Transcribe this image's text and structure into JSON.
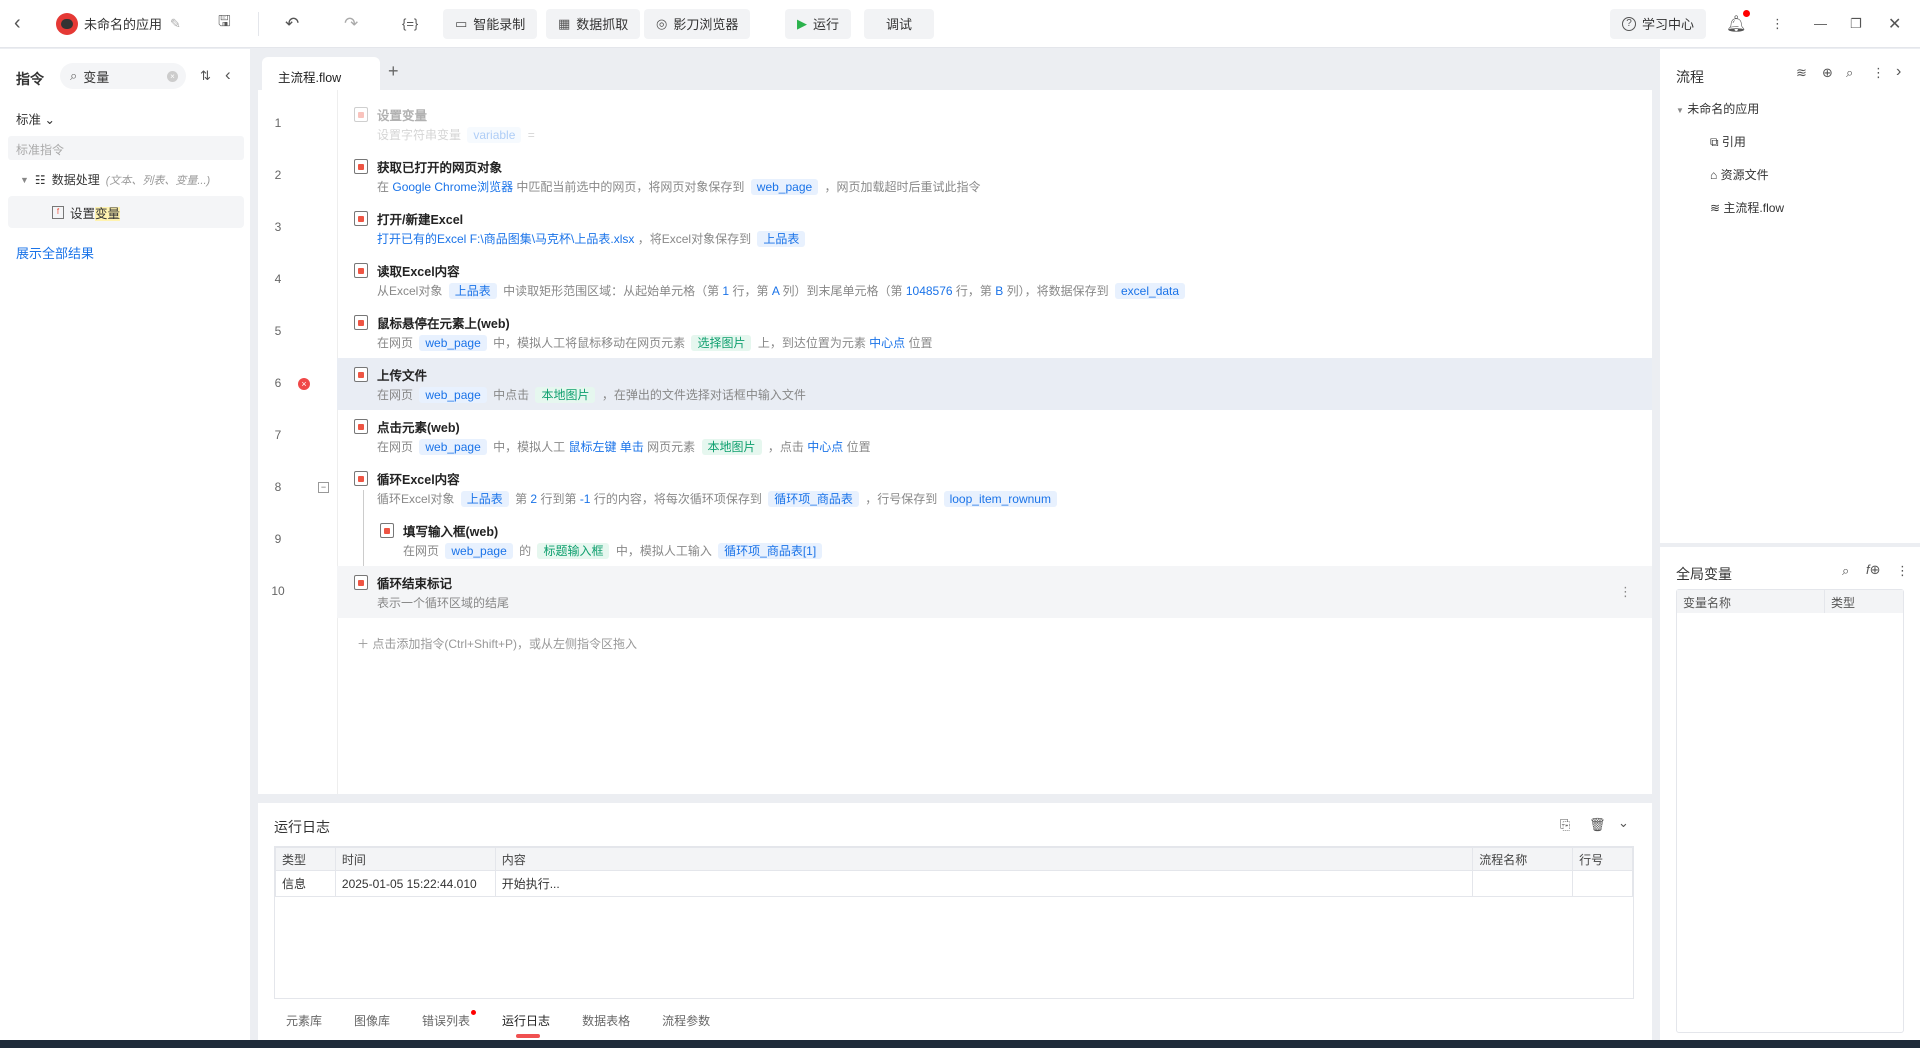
{
  "topbar": {
    "app_title": "未命名的应用",
    "record": "智能录制",
    "scrape": "数据抓取",
    "browser": "影刀浏览器",
    "run": "运行",
    "debug": "调试",
    "learn": "学习中心"
  },
  "left": {
    "title": "指令",
    "search_value": "变量",
    "filter": "标准",
    "category_placeholder": "标准指令",
    "group": "数据处理",
    "group_hint": "(文本、列表、变量...)",
    "item_prefix": "设置",
    "item_highlight": "变量",
    "show_all": "展示全部结果"
  },
  "editor": {
    "tab": "主流程.flow",
    "add_hint": "点击添加指令(Ctrl+Shift+P)，或从左侧指令区拖入",
    "rows": [
      {
        "n": "1",
        "title": "设置变量",
        "disabled": true,
        "desc": [
          {
            "t": "设置字符串变量",
            "k": "p"
          },
          {
            "t": "variable",
            "k": "var"
          },
          {
            "t": "=",
            "k": "p"
          }
        ]
      },
      {
        "n": "2",
        "title": "获取已打开的网页对象",
        "desc": [
          {
            "t": "在",
            "k": "p"
          },
          {
            "t": "Google Chrome浏览器",
            "k": "lk"
          },
          {
            "t": "中匹配当前选中的网页，将网页对象保存到",
            "k": "p"
          },
          {
            "t": "web_page",
            "k": "var"
          },
          {
            "t": "，网页加载超时后重试此指令",
            "k": "p"
          }
        ]
      },
      {
        "n": "3",
        "title": "打开/新建Excel",
        "desc": [
          {
            "t": "打开已有的Excel",
            "k": "lk"
          },
          {
            "t": "F:\\商品图集\\马克杯\\上品表.xlsx",
            "k": "lk"
          },
          {
            "t": "，将Excel对象保存到",
            "k": "p"
          },
          {
            "t": "上品表",
            "k": "var"
          }
        ]
      },
      {
        "n": "4",
        "title": "读取Excel内容",
        "desc": [
          {
            "t": "从Excel对象",
            "k": "p"
          },
          {
            "t": "上品表",
            "k": "var"
          },
          {
            "t": "中读取矩形范围区域：从起始单元格（第",
            "k": "p"
          },
          {
            "t": "1",
            "k": "lk"
          },
          {
            "t": "行，第",
            "k": "p"
          },
          {
            "t": "A",
            "k": "lk"
          },
          {
            "t": "列）到末尾单元格（第",
            "k": "p"
          },
          {
            "t": "1048576",
            "k": "lk"
          },
          {
            "t": "行，第",
            "k": "p"
          },
          {
            "t": "B",
            "k": "lk"
          },
          {
            "t": "列），将数据保存到",
            "k": "p"
          },
          {
            "t": "excel_data",
            "k": "var"
          }
        ]
      },
      {
        "n": "5",
        "title": "鼠标悬停在元素上(web)",
        "desc": [
          {
            "t": "在网页",
            "k": "p"
          },
          {
            "t": "web_page",
            "k": "var"
          },
          {
            "t": "中，模拟人工将鼠标移动在网页元素",
            "k": "p"
          },
          {
            "t": "选择图片",
            "k": "el"
          },
          {
            "t": "上，到达位置为元素",
            "k": "p"
          },
          {
            "t": "中心点",
            "k": "lk"
          },
          {
            "t": "位置",
            "k": "p"
          }
        ]
      },
      {
        "n": "6",
        "title": "上传文件",
        "selected": true,
        "error": true,
        "desc": [
          {
            "t": "在网页",
            "k": "p"
          },
          {
            "t": "web_page",
            "k": "var"
          },
          {
            "t": "中点击",
            "k": "p"
          },
          {
            "t": "本地图片",
            "k": "el"
          },
          {
            "t": "，在弹出的文件选择对话框中输入文件",
            "k": "p"
          }
        ]
      },
      {
        "n": "7",
        "title": "点击元素(web)",
        "desc": [
          {
            "t": "在网页",
            "k": "p"
          },
          {
            "t": "web_page",
            "k": "var"
          },
          {
            "t": "中，模拟人工",
            "k": "p"
          },
          {
            "t": "鼠标左键",
            "k": "lk"
          },
          {
            "t": "单击",
            "k": "lk"
          },
          {
            "t": "网页元素",
            "k": "p"
          },
          {
            "t": "本地图片",
            "k": "el"
          },
          {
            "t": "，点击",
            "k": "p"
          },
          {
            "t": "中心点",
            "k": "lk"
          },
          {
            "t": "位置",
            "k": "p"
          }
        ]
      },
      {
        "n": "8",
        "title": "循环Excel内容",
        "fold": true,
        "desc": [
          {
            "t": "循环Excel对象",
            "k": "p"
          },
          {
            "t": "上品表",
            "k": "var"
          },
          {
            "t": "第",
            "k": "p"
          },
          {
            "t": "2",
            "k": "lk"
          },
          {
            "t": "行到第",
            "k": "p"
          },
          {
            "t": "-1",
            "k": "lk"
          },
          {
            "t": "行的内容，将每次循环项保存到",
            "k": "p"
          },
          {
            "t": "循环项_商品表",
            "k": "var"
          },
          {
            "t": "，行号保存到",
            "k": "p"
          },
          {
            "t": "loop_item_rownum",
            "k": "var"
          }
        ]
      },
      {
        "n": "9",
        "title": "填写输入框(web)",
        "indent": true,
        "desc": [
          {
            "t": "在网页",
            "k": "p"
          },
          {
            "t": "web_page",
            "k": "var"
          },
          {
            "t": "的",
            "k": "p"
          },
          {
            "t": "标题输入框",
            "k": "el"
          },
          {
            "t": "中，模拟人工输入",
            "k": "p"
          },
          {
            "t": "循环项_商品表[1]",
            "k": "var"
          }
        ]
      },
      {
        "n": "10",
        "title": "循环结束标记",
        "gray": true,
        "desc": [
          {
            "t": "表示一个循环区域的结尾",
            "k": "p"
          }
        ]
      }
    ]
  },
  "log": {
    "title": "运行日志",
    "headers": [
      "类型",
      "时间",
      "内容",
      "流程名称",
      "行号"
    ],
    "rows": [
      [
        "信息",
        "2025-01-05 15:22:44.010",
        "开始执行...",
        "",
        ""
      ]
    ],
    "tabs": [
      "元素库",
      "图像库",
      "错误列表",
      "运行日志",
      "数据表格",
      "流程参数"
    ]
  },
  "right": {
    "title": "流程",
    "app": "未命名的应用",
    "items": [
      "引用",
      "资源文件",
      "主流程.flow"
    ],
    "globals_title": "全局变量",
    "globals_headers": [
      "变量名称",
      "类型"
    ]
  }
}
